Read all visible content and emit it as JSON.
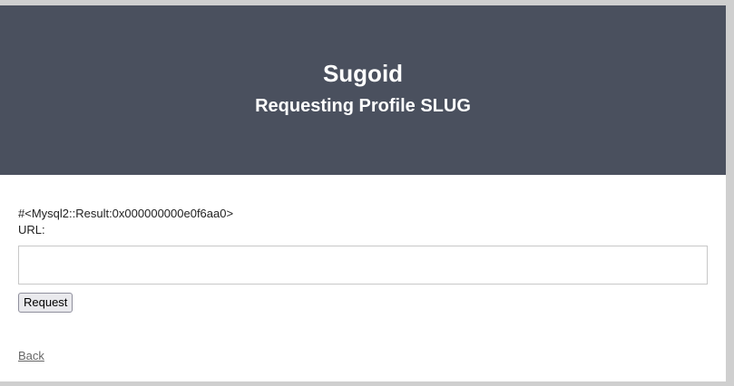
{
  "header": {
    "title": "Sugoid",
    "subtitle": "Requesting Profile SLUG"
  },
  "content": {
    "result_text": "#<Mysql2::Result:0x000000000e0f6aa0>",
    "url_label": "URL:",
    "url_input_value": "",
    "request_button_label": "Request",
    "back_link": "Back"
  },
  "colors": {
    "header_bg": "#4a505e",
    "page_bg": "#ffffff",
    "frame_bg": "#cfcfcf"
  }
}
